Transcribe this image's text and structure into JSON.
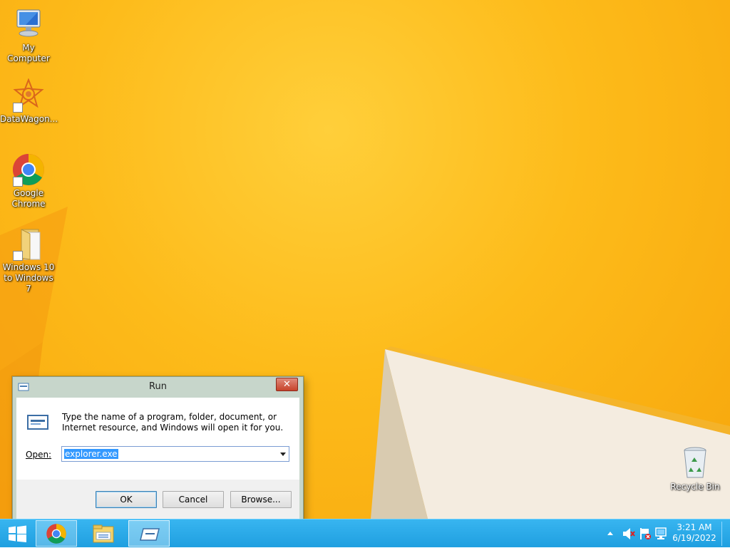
{
  "desktop": {
    "icons": [
      {
        "label": "My Computer",
        "icon": "computer-icon"
      },
      {
        "label": "DataWagon...",
        "icon": "datawagon-icon"
      },
      {
        "label": "Google Chrome",
        "icon": "chrome-icon"
      },
      {
        "label": "Windows 10 to Windows 7",
        "icon": "folder-icon"
      },
      {
        "label": "Recycle Bin",
        "icon": "recycle-bin-icon"
      }
    ]
  },
  "run_dialog": {
    "title": "Run",
    "close_label": "✕",
    "description": "Type the name of a program, folder, document, or Internet resource, and Windows will open it for you.",
    "open_label": "Open:",
    "open_value": "explorer.exe",
    "ok_label": "OK",
    "cancel_label": "Cancel",
    "browse_label": "Browse..."
  },
  "taskbar": {
    "items": [
      "start-button",
      "chrome-icon",
      "file-explorer-icon",
      "run-icon"
    ],
    "clock_time": "3:21 AM",
    "clock_date": "6/19/2022",
    "tray_icons": [
      "show-hidden-icons-arrow",
      "speaker-muted-icon",
      "action-center-flag-icon",
      "network-icon"
    ]
  },
  "colors": {
    "wallpaper": "#fdbb1a",
    "taskbar": "#2aa9e8",
    "selection": "#3399ff"
  }
}
